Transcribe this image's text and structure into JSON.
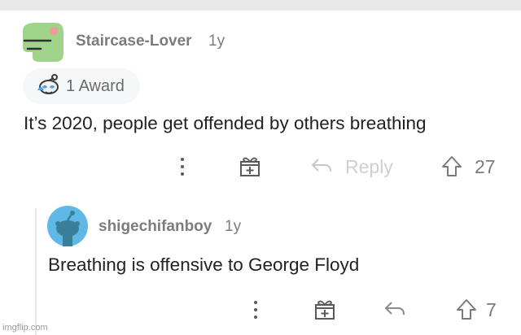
{
  "comments": [
    {
      "username": "Staircase-Lover",
      "age": "1y",
      "award": {
        "label": "1 Award",
        "icon": "wholesome-award-icon"
      },
      "body": "It’s 2020, people get offended by others breathing",
      "actions": {
        "more_icon": "more-vertical-icon",
        "give_award_icon": "gift-icon",
        "reply_icon": "reply-arrow-icon",
        "reply_label": "Reply",
        "upvote_icon": "upvote-arrow-icon",
        "score": "27"
      },
      "avatar_colors": {
        "body": "#9fd38a",
        "cheek": "#f29999"
      }
    },
    {
      "username": "shigechifanboy",
      "age": "1y",
      "body": "Breathing is offensive to George Floyd",
      "actions": {
        "more_icon": "more-vertical-icon",
        "give_award_icon": "gift-icon",
        "reply_icon": "reply-arrow-icon",
        "upvote_icon": "upvote-arrow-icon",
        "score": "7"
      },
      "avatar_colors": {
        "background": "#5fb8e6",
        "figure": "#3a7f9a"
      }
    }
  ],
  "watermark": "imgflip.com"
}
